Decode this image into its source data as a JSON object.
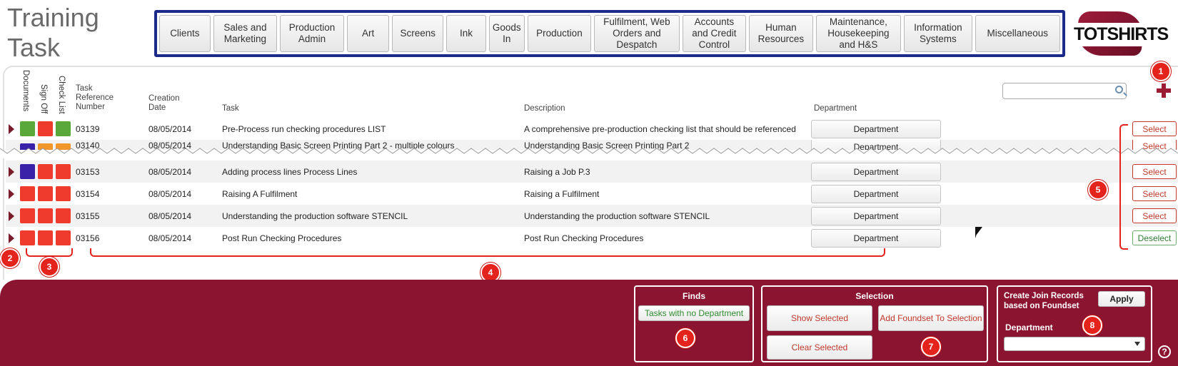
{
  "app": {
    "title_line1": "Training",
    "title_line2": "Task",
    "logo_text": "TOTSHIRTS"
  },
  "nav": [
    {
      "label": "Clients"
    },
    {
      "label": "Sales and Marketing"
    },
    {
      "label": "Production Admin"
    },
    {
      "label": "Art"
    },
    {
      "label": "Screens"
    },
    {
      "label": "Ink"
    },
    {
      "label": "Goods In"
    },
    {
      "label": "Production"
    },
    {
      "label": "Fulfilment, Web Orders and Despatch"
    },
    {
      "label": "Accounts and Credit Control"
    },
    {
      "label": "Human Resources"
    },
    {
      "label": "Maintenance, Housekeeping and H&S"
    },
    {
      "label": "Information Systems"
    },
    {
      "label": "Miscellaneous"
    }
  ],
  "table": {
    "headers": {
      "documents": "Documents",
      "sign_off": "Sign Off",
      "check_list": "Check List",
      "task_ref": "Task Reference Number",
      "creation_date": "Creation Date",
      "task": "Task",
      "description": "Description",
      "department": "Department"
    },
    "search": {
      "placeholder": ""
    },
    "rows": [
      {
        "ref": "03139",
        "date": "08/05/2014",
        "task": "Pre-Process run checking procedures LIST",
        "description": "A comprehensive pre-production checking list that should be referenced",
        "department": "Department",
        "select": "Select",
        "status": [
          "#5aa83a",
          "#ef3b2e",
          "#5aa83a"
        ]
      },
      {
        "ref": "03140",
        "date": "08/05/2014",
        "task": "Understanding Basic Screen Printing Part 2 - multiple colours",
        "description": "Understanding Basic Screen Printing Part 2",
        "department": "Department",
        "select": "Select",
        "status": [
          "#3a22a8",
          "#f0962a",
          "#f0962a"
        ]
      },
      {
        "ref": "03153",
        "date": "08/05/2014",
        "task": "Adding process lines Process Lines",
        "description": "Raising a Job P.3",
        "department": "Department",
        "select": "Select",
        "status": [
          "#3a22a8",
          "#ef3b2e",
          "#ef3b2e"
        ]
      },
      {
        "ref": "03154",
        "date": "08/05/2014",
        "task": "Raising A Fulfilment",
        "description": "Raising a Fulfilment",
        "department": "Department",
        "select": "Select",
        "status": [
          "#ef3b2e",
          "#ef3b2e",
          "#ef3b2e"
        ]
      },
      {
        "ref": "03155",
        "date": "08/05/2014",
        "task": "Understanding the production software STENCIL",
        "description": "Understanding the production software STENCIL",
        "department": "Department",
        "select": "Select",
        "status": [
          "#ef3b2e",
          "#ef3b2e",
          "#ef3b2e"
        ]
      },
      {
        "ref": "03156",
        "date": "08/05/2014",
        "task": "Post Run Checking Procedures",
        "description": "Post Run Checking Procedures",
        "department": "Department",
        "select": "Deselect",
        "status": [
          "#ef3b2e",
          "#ef3b2e",
          "#ef3b2e"
        ]
      }
    ]
  },
  "footer": {
    "finds": {
      "title": "Finds",
      "tasks_no_dept": "Tasks with no Department"
    },
    "selection": {
      "title": "Selection",
      "show_selected": "Show Selected",
      "add_foundset": "Add Foundset To Selection",
      "clear_selected": "Clear Selected"
    },
    "join": {
      "title": "Create Join Records based on Foundset",
      "apply": "Apply",
      "department_label": "Department",
      "department_value": ""
    },
    "help": "?"
  },
  "callouts": [
    "1",
    "2",
    "3",
    "4",
    "5",
    "6",
    "7",
    "8"
  ]
}
